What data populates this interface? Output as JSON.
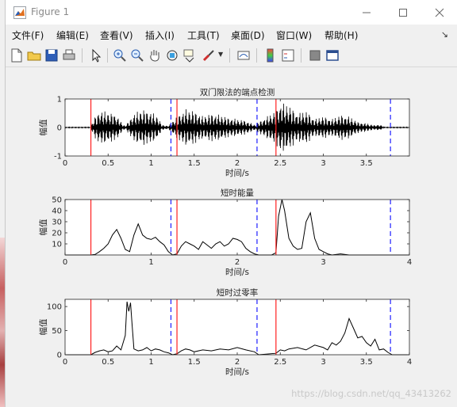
{
  "window": {
    "title": "Figure 1"
  },
  "menu": [
    "文件(F)",
    "编辑(E)",
    "查看(V)",
    "插入(I)",
    "工具(T)",
    "桌面(D)",
    "窗口(W)",
    "帮助(H)"
  ],
  "toolbar": [
    "new-figure-icon",
    "open-folder-icon",
    "save-icon",
    "print-icon",
    "pointer-icon",
    "zoom-in-icon",
    "zoom-out-icon",
    "pan-hand-icon",
    "rotate-3d-icon",
    "data-cursor-icon",
    "brush-icon",
    "link-plot-icon",
    "colorbar-icon",
    "legend-icon",
    "hide-plot-tools-icon",
    "show-plot-tools-icon"
  ],
  "colors": {
    "red_marker": "#ff2020",
    "blue_marker": "#2020ff",
    "waveform": "#000000"
  },
  "watermark": "https://blog.csdn.net/qq_43413262",
  "chart_data": [
    {
      "type": "line",
      "title": "双门限法的端点检测",
      "xlabel": "时间/s",
      "ylabel": "幅值",
      "xlim": [
        0,
        4
      ],
      "ylim": [
        -1,
        1
      ],
      "xticks": [
        "0",
        "0.5",
        "1",
        "1.5",
        "2",
        "2.5",
        "3",
        "3.5"
      ],
      "yticks": [
        "-1",
        "0",
        "1"
      ],
      "speech_segments": [
        [
          0.3,
          1.23
        ],
        [
          1.3,
          2.23
        ],
        [
          2.45,
          3.78
        ]
      ],
      "red_lines": [
        0.3,
        1.3,
        2.45
      ],
      "blue_dashed_lines": [
        1.23,
        2.23,
        3.78
      ],
      "envelope": [
        [
          0.3,
          0.05
        ],
        [
          0.33,
          0.3
        ],
        [
          0.4,
          0.6
        ],
        [
          0.5,
          0.55
        ],
        [
          0.6,
          0.45
        ],
        [
          0.65,
          0.2
        ],
        [
          0.7,
          0.05
        ],
        [
          0.8,
          0.5
        ],
        [
          0.9,
          0.65
        ],
        [
          1.0,
          0.55
        ],
        [
          1.08,
          0.4
        ],
        [
          1.12,
          0.1
        ],
        [
          1.2,
          0.05
        ],
        [
          1.3,
          0.4
        ],
        [
          1.4,
          0.65
        ],
        [
          1.5,
          0.6
        ],
        [
          1.6,
          0.4
        ],
        [
          1.7,
          0.5
        ],
        [
          1.8,
          0.45
        ],
        [
          1.9,
          0.35
        ],
        [
          2.0,
          0.3
        ],
        [
          2.1,
          0.25
        ],
        [
          2.2,
          0.1
        ],
        [
          2.45,
          0.6
        ],
        [
          2.5,
          0.9
        ],
        [
          2.6,
          0.8
        ],
        [
          2.7,
          0.5
        ],
        [
          2.8,
          0.6
        ],
        [
          2.9,
          0.3
        ],
        [
          3.0,
          0.4
        ],
        [
          3.1,
          0.3
        ],
        [
          3.2,
          0.45
        ],
        [
          3.3,
          0.4
        ],
        [
          3.4,
          0.2
        ],
        [
          3.5,
          0.15
        ],
        [
          3.6,
          0.08
        ],
        [
          3.65,
          0.12
        ],
        [
          3.7,
          0.03
        ]
      ]
    },
    {
      "type": "line",
      "title": "短时能量",
      "xlabel": "时间/s",
      "ylabel": "幅值",
      "xlim": [
        0,
        4
      ],
      "ylim": [
        0,
        50
      ],
      "xticks": [
        "0",
        "1",
        "2",
        "3",
        "4"
      ],
      "yticks": [
        "10",
        "20",
        "30",
        "40",
        "50"
      ],
      "red_lines": [
        0.3,
        1.3,
        2.45
      ],
      "blue_dashed_lines": [
        1.23,
        2.23,
        3.78
      ],
      "x": [
        0,
        0.25,
        0.3,
        0.35,
        0.4,
        0.45,
        0.5,
        0.55,
        0.6,
        0.65,
        0.7,
        0.75,
        0.8,
        0.85,
        0.9,
        0.95,
        1.0,
        1.05,
        1.1,
        1.15,
        1.2,
        1.25,
        1.3,
        1.35,
        1.4,
        1.45,
        1.5,
        1.55,
        1.6,
        1.65,
        1.7,
        1.75,
        1.8,
        1.85,
        1.9,
        1.95,
        2.0,
        2.05,
        2.1,
        2.15,
        2.2,
        2.25,
        2.4,
        2.45,
        2.48,
        2.52,
        2.55,
        2.6,
        2.65,
        2.7,
        2.75,
        2.8,
        2.85,
        2.9,
        2.95,
        3.0,
        3.05,
        3.1,
        3.2,
        3.3,
        3.4,
        3.5,
        3.6,
        3.7,
        3.8,
        4.0
      ],
      "y": [
        0,
        0,
        0,
        0.5,
        3,
        6,
        10,
        18,
        23,
        15,
        5,
        3,
        18,
        28,
        18,
        15,
        14,
        16,
        12,
        9,
        3,
        0,
        1,
        8,
        12,
        10,
        8,
        5,
        12,
        9,
        6,
        10,
        12,
        8,
        10,
        15,
        14,
        12,
        6,
        3,
        1,
        0,
        0,
        2,
        35,
        50,
        40,
        15,
        8,
        5,
        6,
        30,
        38,
        15,
        5,
        3,
        1,
        0,
        1,
        0,
        0,
        0,
        0,
        0,
        0,
        0
      ]
    },
    {
      "type": "line",
      "title": "短时过零率",
      "xlabel": "时间/s",
      "ylabel": "幅值",
      "xlim": [
        0,
        4
      ],
      "ylim": [
        0,
        115
      ],
      "xticks": [
        "0",
        "0.5",
        "1",
        "1.5",
        "2",
        "2.5",
        "3",
        "3.5",
        "4"
      ],
      "yticks": [
        "0",
        "50",
        "100"
      ],
      "red_lines": [
        0.3,
        1.3,
        2.45
      ],
      "blue_dashed_lines": [
        1.23,
        2.23,
        3.78
      ],
      "x": [
        0,
        0.3,
        0.35,
        0.4,
        0.45,
        0.5,
        0.55,
        0.6,
        0.65,
        0.7,
        0.72,
        0.74,
        0.76,
        0.78,
        0.8,
        0.85,
        0.9,
        0.95,
        1.0,
        1.05,
        1.1,
        1.15,
        1.2,
        1.25,
        1.3,
        1.35,
        1.4,
        1.45,
        1.5,
        1.6,
        1.7,
        1.8,
        1.9,
        2.0,
        2.1,
        2.2,
        2.25,
        2.45,
        2.5,
        2.55,
        2.6,
        2.7,
        2.8,
        2.9,
        3.0,
        3.05,
        3.1,
        3.15,
        3.2,
        3.25,
        3.3,
        3.35,
        3.4,
        3.45,
        3.5,
        3.55,
        3.6,
        3.65,
        3.7,
        3.75,
        3.8,
        4.0
      ],
      "y": [
        0,
        0,
        5,
        8,
        10,
        6,
        8,
        18,
        10,
        40,
        110,
        90,
        108,
        60,
        12,
        8,
        10,
        15,
        8,
        12,
        10,
        6,
        4,
        0,
        2,
        8,
        12,
        10,
        6,
        10,
        8,
        12,
        10,
        15,
        10,
        6,
        0,
        3,
        10,
        8,
        12,
        15,
        10,
        20,
        15,
        10,
        25,
        20,
        28,
        45,
        75,
        55,
        35,
        38,
        25,
        18,
        32,
        10,
        12,
        5,
        0,
        0
      ]
    }
  ]
}
